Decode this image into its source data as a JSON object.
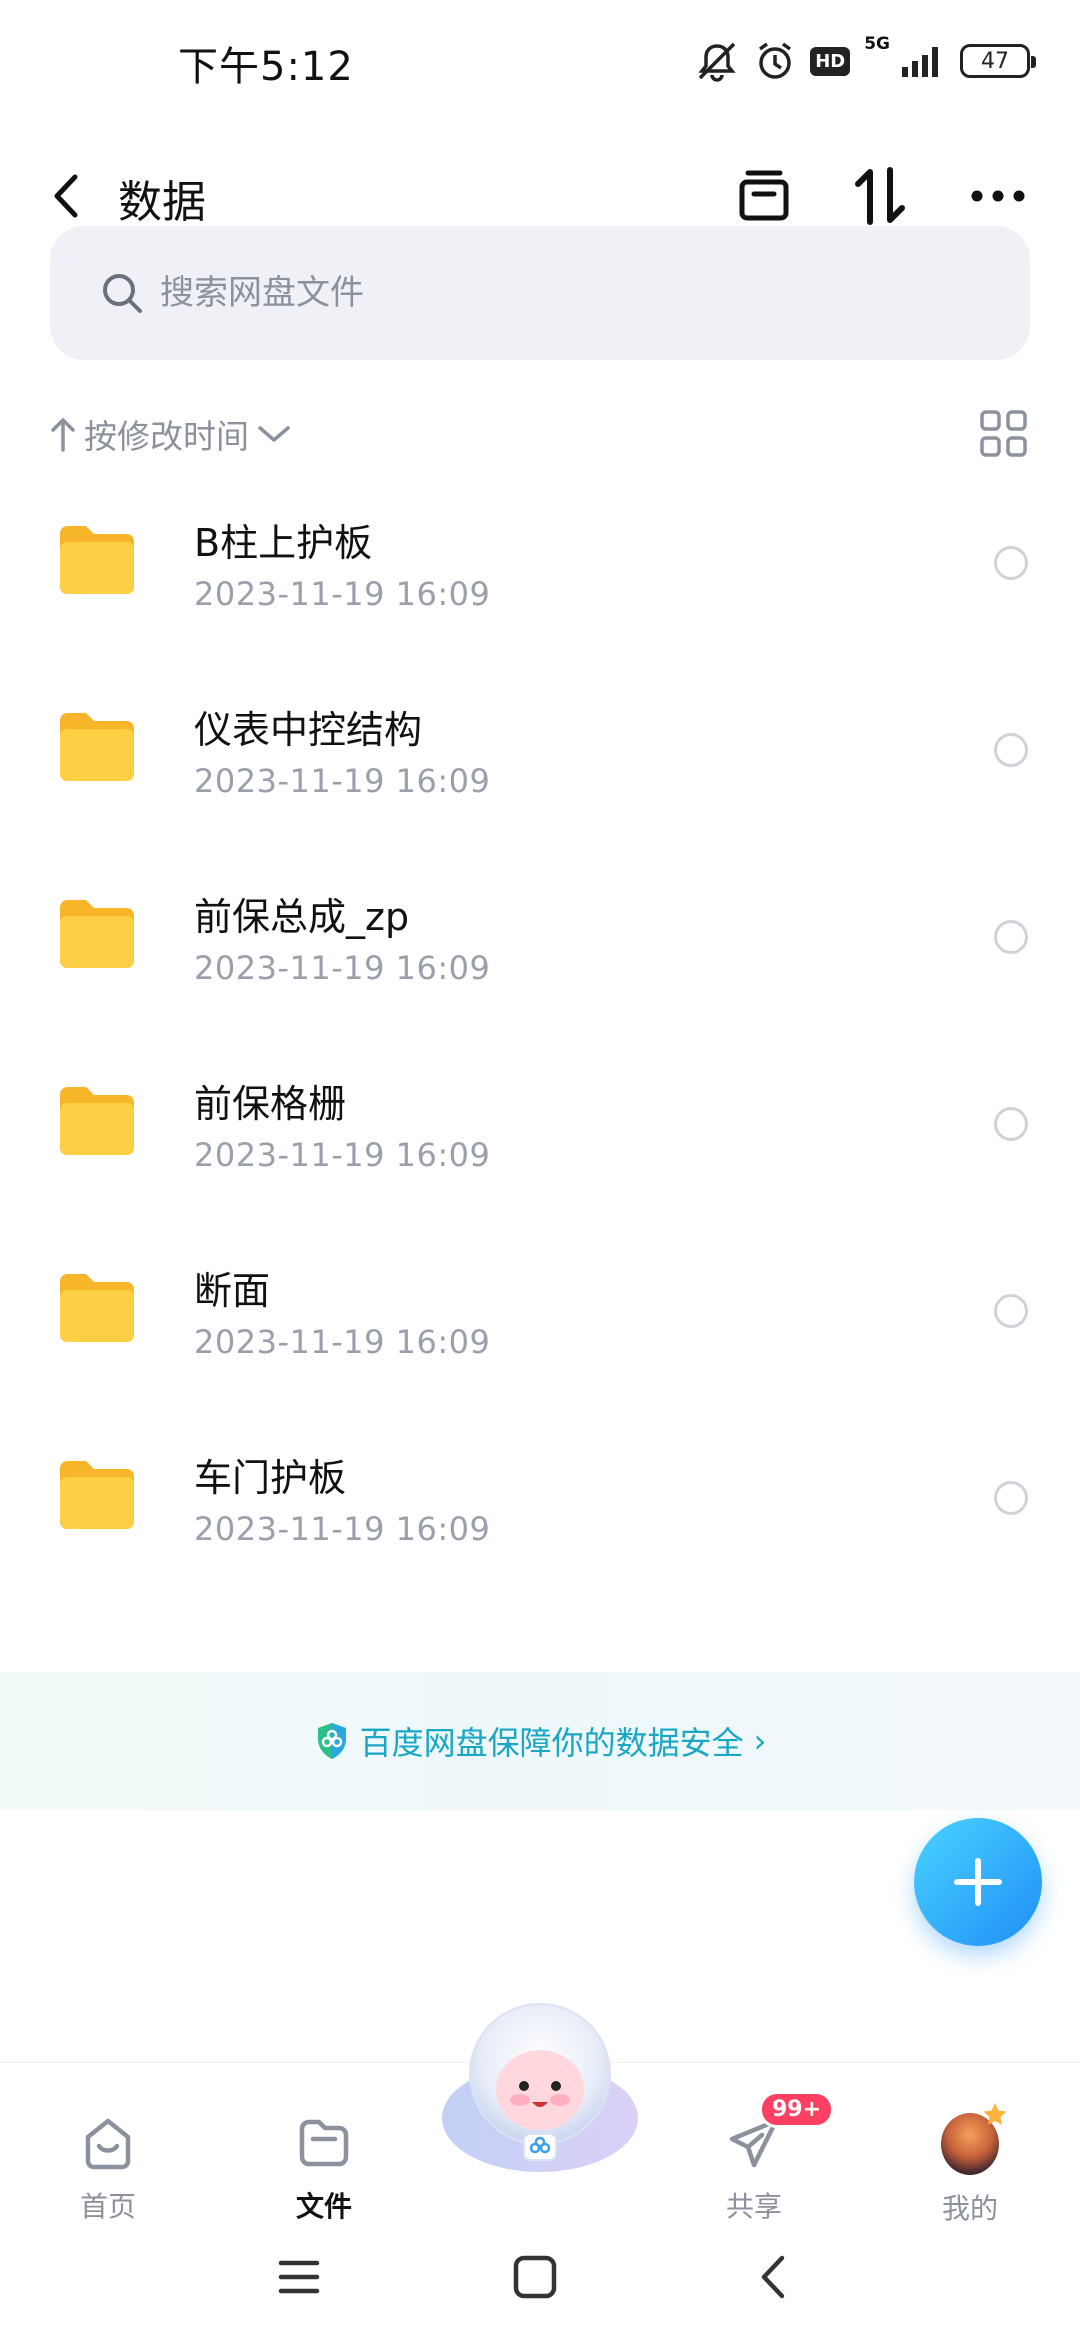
{
  "status_bar": {
    "time": "下午5:12",
    "network": "5G",
    "hd": "HD",
    "battery": "47",
    "icons": [
      "mute-bell-icon",
      "alarm-icon",
      "hd-icon",
      "signal-icon",
      "battery-icon"
    ]
  },
  "header": {
    "title": "数据",
    "icons": [
      "back-icon",
      "archive-icon",
      "sort-transfer-icon",
      "more-icon"
    ]
  },
  "search": {
    "placeholder": "搜索网盘文件"
  },
  "sort": {
    "label": "按修改时间",
    "view_mode_icon": "grid-view-icon"
  },
  "files": [
    {
      "name": "B柱上护板",
      "date": "2023-11-19  16:09"
    },
    {
      "name": "仪表中控结构",
      "date": "2023-11-19  16:09"
    },
    {
      "name": "前保总成_zp",
      "date": "2023-11-19  16:09"
    },
    {
      "name": "前保格栅",
      "date": "2023-11-19  16:09"
    },
    {
      "name": "断面",
      "date": "2023-11-19  16:09"
    },
    {
      "name": "车门护板",
      "date": "2023-11-19  16:09"
    }
  ],
  "security_banner": {
    "text": "百度网盘保障你的数据安全",
    "chevron": "›"
  },
  "bottom_nav": {
    "home": "首页",
    "files": "文件",
    "share": "共享",
    "share_badge": "99+",
    "mine": "我的"
  },
  "colors": {
    "accent": "#19a7c3",
    "fab_start": "#4ad3ff",
    "fab_end": "#1f8ff7",
    "folder": "#fdc93a",
    "badge": "#ff4062"
  }
}
